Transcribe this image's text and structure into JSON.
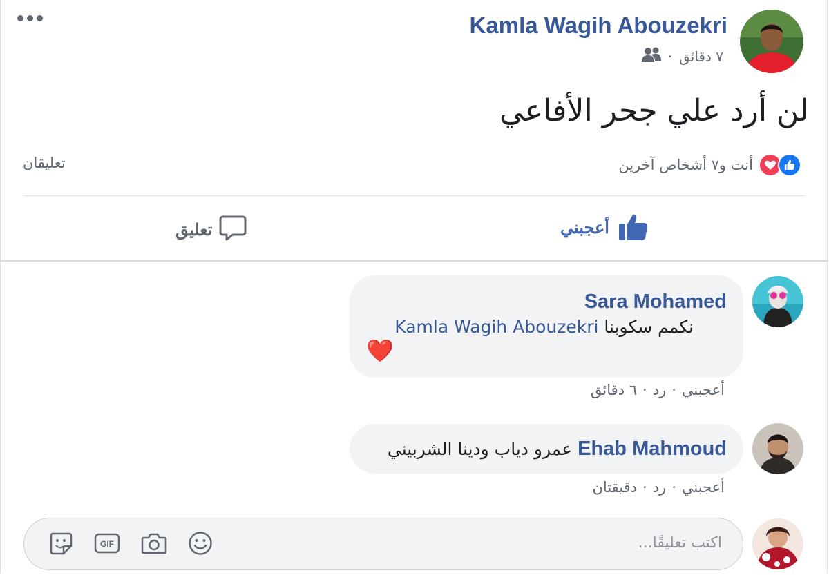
{
  "post": {
    "author": "Kamla Wagih Abouzekri",
    "time": "٧ دقائق",
    "separator": "·",
    "audience_icon": "friends-icon",
    "text": "لن أرد علي جحر الأفاعي",
    "reactions_summary": "أنت و٧ أشخاص آخرين",
    "comments_count": "تعليقان",
    "like_label": "أعجبني",
    "comment_label": "تعليق",
    "colors": {
      "name": "#385898",
      "like_blue": "#1877f2",
      "love_red": "#f33e58",
      "muted": "#606770"
    }
  },
  "comments": [
    {
      "name": "Sara Mohamed",
      "text": "نكمم سكوبنا",
      "mention": "Kamla Wagih Abouzekri",
      "emoji": "❤️",
      "like": "أعجبني",
      "reply": "رد",
      "time": "٦ دقائق",
      "sep": "·"
    },
    {
      "name": "Ehab Mahmoud",
      "text": "عمرو دياب ودينا الشربيني",
      "like": "أعجبني",
      "reply": "رد",
      "time": "دقيقتان",
      "sep": "·"
    }
  ],
  "composer": {
    "placeholder": "اكتب تعليقًا..."
  }
}
